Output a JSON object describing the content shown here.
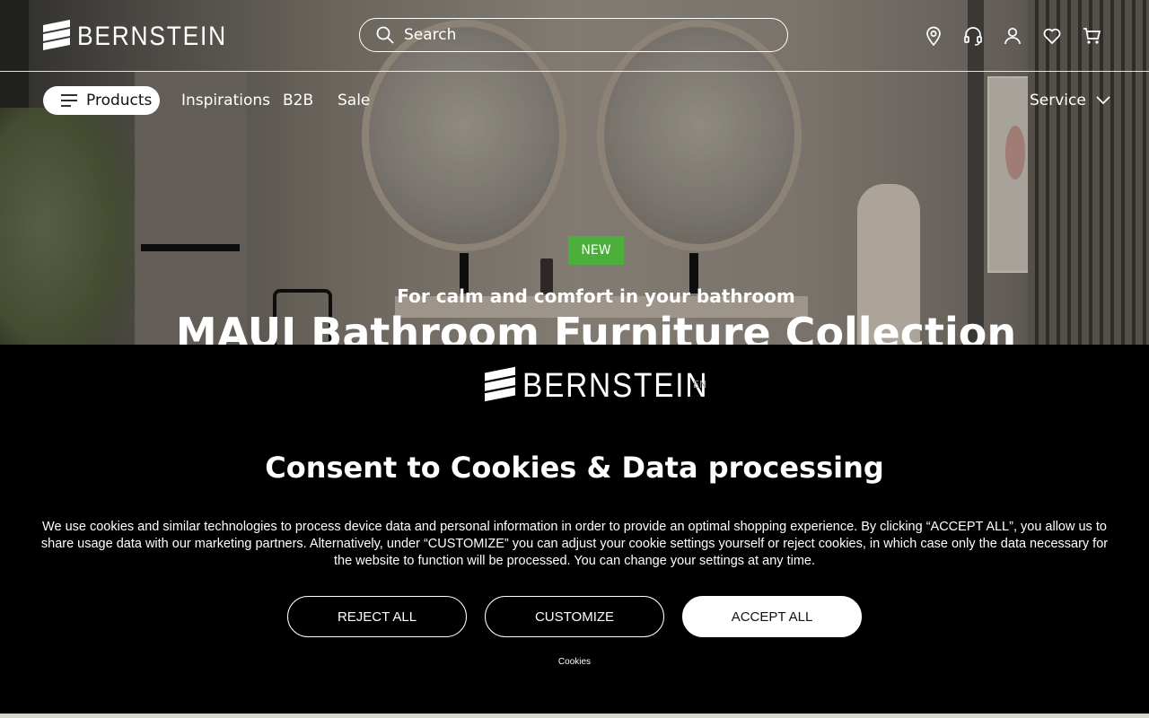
{
  "brand": {
    "name": "BERNSTEIN"
  },
  "header": {
    "search_placeholder": "Search",
    "icons": [
      "location-icon",
      "headset-icon",
      "account-icon",
      "wishlist-icon",
      "cart-icon"
    ]
  },
  "nav": {
    "products_label": "Products",
    "links": [
      "Inspirations",
      "B2B",
      "Sale"
    ],
    "service_label": "Service"
  },
  "hero": {
    "badge": "NEW",
    "tagline": "For calm and comfort in your bathroom",
    "headline": "MAUI Bathroom Furniture Collection",
    "badge_color": "#4caf3c"
  },
  "cookie": {
    "language": "EN",
    "title": "Consent to Cookies & Data processing",
    "text": "We use cookies and similar technologies to process device data and personal information in order to provide an optimal shopping experience. By clicking “ACCEPT ALL”, you allow us to share usage data with our marketing partners. Alternatively, under “CUSTOMIZE” you can adjust your cookie settings yourself or reject cookies, in which case only the data necessary for the website to function will be processed. You can change your settings at any time.",
    "reject_label": "REJECT ALL",
    "customize_label": "CUSTOMIZE",
    "accept_label": "ACCEPT ALL",
    "cookies_link": "Cookies"
  }
}
